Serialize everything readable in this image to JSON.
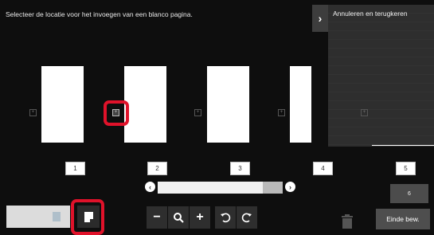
{
  "header": {
    "instruction": "Selecteer de locatie voor het invoegen van een blanco pagina.",
    "panel_toggle_icon": "chevron-right-icon",
    "panel_label": "Annuleren en terugkeren"
  },
  "pages": [
    {
      "number": "1"
    },
    {
      "number": "2"
    },
    {
      "number": "3"
    },
    {
      "number": "4"
    },
    {
      "number": "5"
    }
  ],
  "insertion_marker_glyph": "+",
  "selected_insertion_after_page": "1",
  "scrollbar": {
    "position_fraction": 0.84
  },
  "page_count_button": "6",
  "toolbar": {
    "zoom_out": "−",
    "zoom_in": "+",
    "zoom_icon": "magnifier-icon",
    "rotate_left_icon": "rotate-left-icon",
    "rotate_right_icon": "rotate-right-icon",
    "blank_page_icon": "blank-page-icon",
    "delete_icon": "trash-icon",
    "finish_label": "Einde bew."
  },
  "colors": {
    "background": "#0e0e0e",
    "highlight": "#e0122a",
    "page": "#ffffff"
  }
}
